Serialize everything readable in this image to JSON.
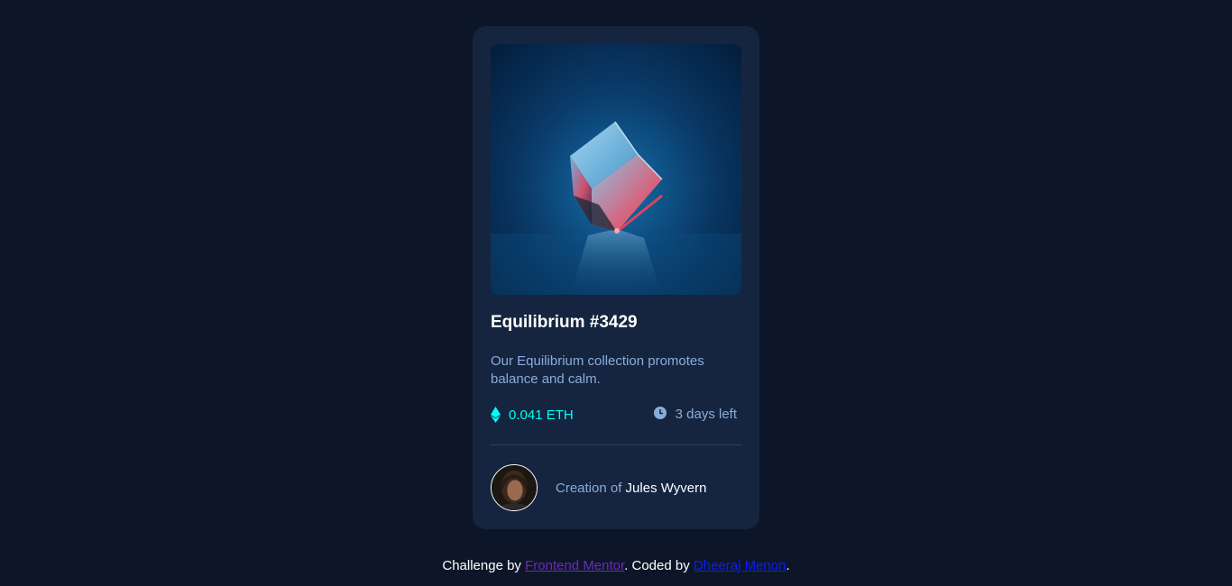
{
  "card": {
    "image_alt": "equilibrium cube",
    "title": "Equilibrium #3429",
    "description": "Our Equilibrium collection promotes balance and calm.",
    "price": "0.041 ETH",
    "time_left": "3 days left",
    "creator_prefix": "Creation of ",
    "creator_name": "Jules Wyvern",
    "icons": {
      "price": "ethereum-icon",
      "time": "clock-icon"
    }
  },
  "footer": {
    "challenge_prefix": "Challenge by ",
    "challenge_link": "Frontend Mentor",
    "coded_prefix": ". Coded by ",
    "coded_link": "Dheeraj Menon",
    "end": "."
  },
  "colors": {
    "page_bg": "#0d1628",
    "card_bg": "#15253f",
    "accent_cyan": "#00fff8",
    "soft_blue": "#8bacd9",
    "white": "#ffffff"
  }
}
